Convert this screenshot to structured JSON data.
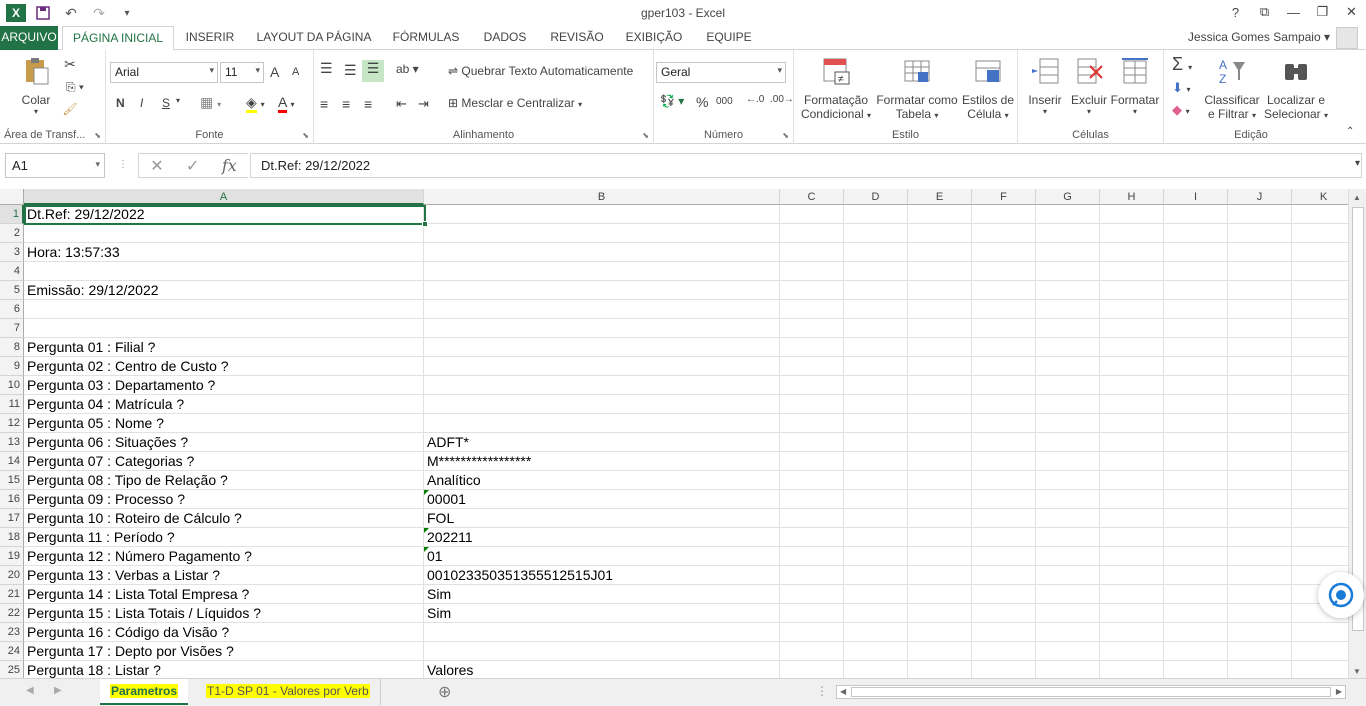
{
  "app": {
    "title": "gper103 - Excel",
    "brand_color": "#217346"
  },
  "qat": {
    "icons": [
      "excel-logo",
      "save-icon",
      "undo-icon",
      "redo-icon",
      "customize-icon"
    ]
  },
  "window": {
    "help": "?",
    "restore_ribbon": "⧉",
    "minimize": "—",
    "maximize": "❐",
    "close": "✕"
  },
  "tabs": [
    "ARQUIVO",
    "PÁGINA INICIAL",
    "INSERIR",
    "LAYOUT DA PÁGINA",
    "FÓRMULAS",
    "DADOS",
    "REVISÃO",
    "EXIBIÇÃO",
    "EQUIPE"
  ],
  "user": {
    "name": "Jessica Gomes Sampaio"
  },
  "ribbon": {
    "clipboard": {
      "label": "Área de Transf...",
      "paste": "Colar"
    },
    "font": {
      "label": "Fonte",
      "family": "Arial",
      "size": "11",
      "grow": "A",
      "shrink": "A",
      "bold": "N",
      "italic": "I",
      "underline": "S"
    },
    "alignment": {
      "label": "Alinhamento",
      "wrap": "Quebrar Texto Automaticamente",
      "merge": "Mesclar e Centralizar"
    },
    "number": {
      "label": "Número",
      "format": "Geral",
      "percent": "%",
      "thousands": "000"
    },
    "styles": {
      "label": "Estilo",
      "conditional_1": "Formatação",
      "conditional_2": "Condicional",
      "table_1": "Formatar como",
      "table_2": "Tabela",
      "cell_1": "Estilos de",
      "cell_2": "Célula"
    },
    "cells": {
      "label": "Células",
      "insert": "Inserir",
      "delete": "Excluir",
      "format": "Formatar"
    },
    "editing": {
      "label": "Edição",
      "sort_1": "Classificar",
      "sort_2": "e Filtrar",
      "find_1": "Localizar e",
      "find_2": "Selecionar"
    }
  },
  "formula_bar": {
    "name_box": "A1",
    "formula": "Dt.Ref: 29/12/2022",
    "fx": "fx"
  },
  "columns": [
    "A",
    "B",
    "C",
    "D",
    "E",
    "F",
    "G",
    "H",
    "I",
    "J",
    "K"
  ],
  "rows": [
    {
      "n": "1",
      "a": "Dt.Ref: 29/12/2022",
      "b": ""
    },
    {
      "n": "2",
      "a": "",
      "b": ""
    },
    {
      "n": "3",
      "a": "Hora: 13:57:33",
      "b": ""
    },
    {
      "n": "4",
      "a": "",
      "b": ""
    },
    {
      "n": "5",
      "a": "Emissão: 29/12/2022",
      "b": ""
    },
    {
      "n": "6",
      "a": "",
      "b": ""
    },
    {
      "n": "7",
      "a": "",
      "b": ""
    },
    {
      "n": "8",
      "a": "Pergunta 01 : Filial ?",
      "b": ""
    },
    {
      "n": "9",
      "a": "Pergunta 02 : Centro de Custo ?",
      "b": ""
    },
    {
      "n": "10",
      "a": "Pergunta 03 : Departamento ?",
      "b": ""
    },
    {
      "n": "11",
      "a": "Pergunta 04 : Matrícula ?",
      "b": ""
    },
    {
      "n": "12",
      "a": "Pergunta 05 : Nome ?",
      "b": ""
    },
    {
      "n": "13",
      "a": "Pergunta 06 : Situações ?",
      "b": " ADFT*"
    },
    {
      "n": "14",
      "a": "Pergunta 07 : Categorias ?",
      "b": "M*****************"
    },
    {
      "n": "15",
      "a": "Pergunta 08 : Tipo de Relação ?",
      "b": "Analítico"
    },
    {
      "n": "16",
      "a": "Pergunta 09 : Processo ?",
      "b": "00001",
      "tri": true
    },
    {
      "n": "17",
      "a": "Pergunta 10 : Roteiro de Cálculo ?",
      "b": "FOL"
    },
    {
      "n": "18",
      "a": "Pergunta 11 : Período ?",
      "b": "202211",
      "tri": true
    },
    {
      "n": "19",
      "a": "Pergunta 12 : Número Pagamento ?",
      "b": "01",
      "tri": true
    },
    {
      "n": "20",
      "a": "Pergunta 13 : Verbas a Listar ?",
      "b": "001023350351355512515J01"
    },
    {
      "n": "21",
      "a": "Pergunta 14 : Lista Total Empresa ?",
      "b": "Sim"
    },
    {
      "n": "22",
      "a": "Pergunta 15 : Lista Totais / Líquidos ?",
      "b": "Sim"
    },
    {
      "n": "23",
      "a": "Pergunta 16 : Código da Visão ?",
      "b": ""
    },
    {
      "n": "24",
      "a": "Pergunta 17 : Depto por Visões ?",
      "b": ""
    },
    {
      "n": "25",
      "a": "Pergunta 18 : Listar ?",
      "b": "Valores"
    }
  ],
  "sheets": [
    "Parametros",
    "T1-D SP 01  - Valores por Verb"
  ],
  "add_sheet": "⊕"
}
